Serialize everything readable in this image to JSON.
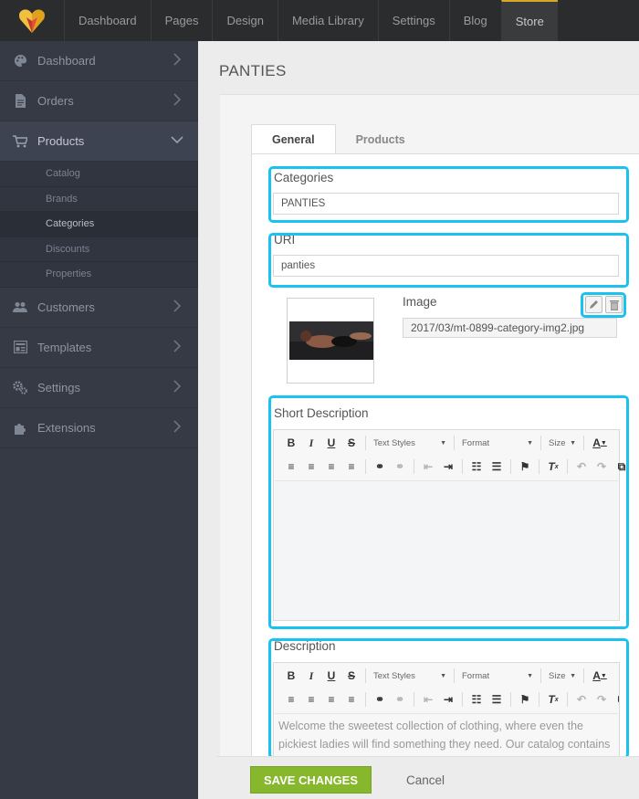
{
  "topnav": {
    "items": [
      "Dashboard",
      "Pages",
      "Design",
      "Media Library",
      "Settings",
      "Blog",
      "Store"
    ],
    "active": "Store"
  },
  "sidebar": {
    "items": [
      {
        "label": "Dashboard",
        "icon": "palette-icon"
      },
      {
        "label": "Orders",
        "icon": "document-icon"
      },
      {
        "label": "Products",
        "icon": "cart-icon",
        "open": true,
        "children": [
          "Catalog",
          "Brands",
          "Categories",
          "Discounts",
          "Properties"
        ],
        "active_child": "Categories"
      },
      {
        "label": "Customers",
        "icon": "users-icon"
      },
      {
        "label": "Templates",
        "icon": "template-icon"
      },
      {
        "label": "Settings",
        "icon": "gears-icon"
      },
      {
        "label": "Extensions",
        "icon": "puzzle-icon"
      }
    ]
  },
  "page": {
    "title": "PANTIES"
  },
  "tabs": {
    "general": "General",
    "products": "Products"
  },
  "form": {
    "categories_label": "Categories",
    "categories_value": "PANTIES",
    "uri_label": "URI",
    "uri_value": "panties",
    "image_label": "Image",
    "image_value": "2017/03/mt-0899-category-img2.jpg",
    "short_desc_label": "Short Description",
    "description_label": "Description",
    "description_text": "Welcome the sweetest collection of clothing, where even the pickiest ladies will find something they need. Our catalog contains the best of underwear. Everything here is"
  },
  "editor": {
    "text_styles": "Text Styles",
    "format": "Format",
    "size": "Size"
  },
  "footer": {
    "save": "SAVE CHANGES",
    "cancel": "Cancel"
  },
  "colors": {
    "highlight": "#1ac2ef",
    "save_button": "#86b72c",
    "sidebar": "#353a45",
    "topbar": "#2b2c2d"
  }
}
